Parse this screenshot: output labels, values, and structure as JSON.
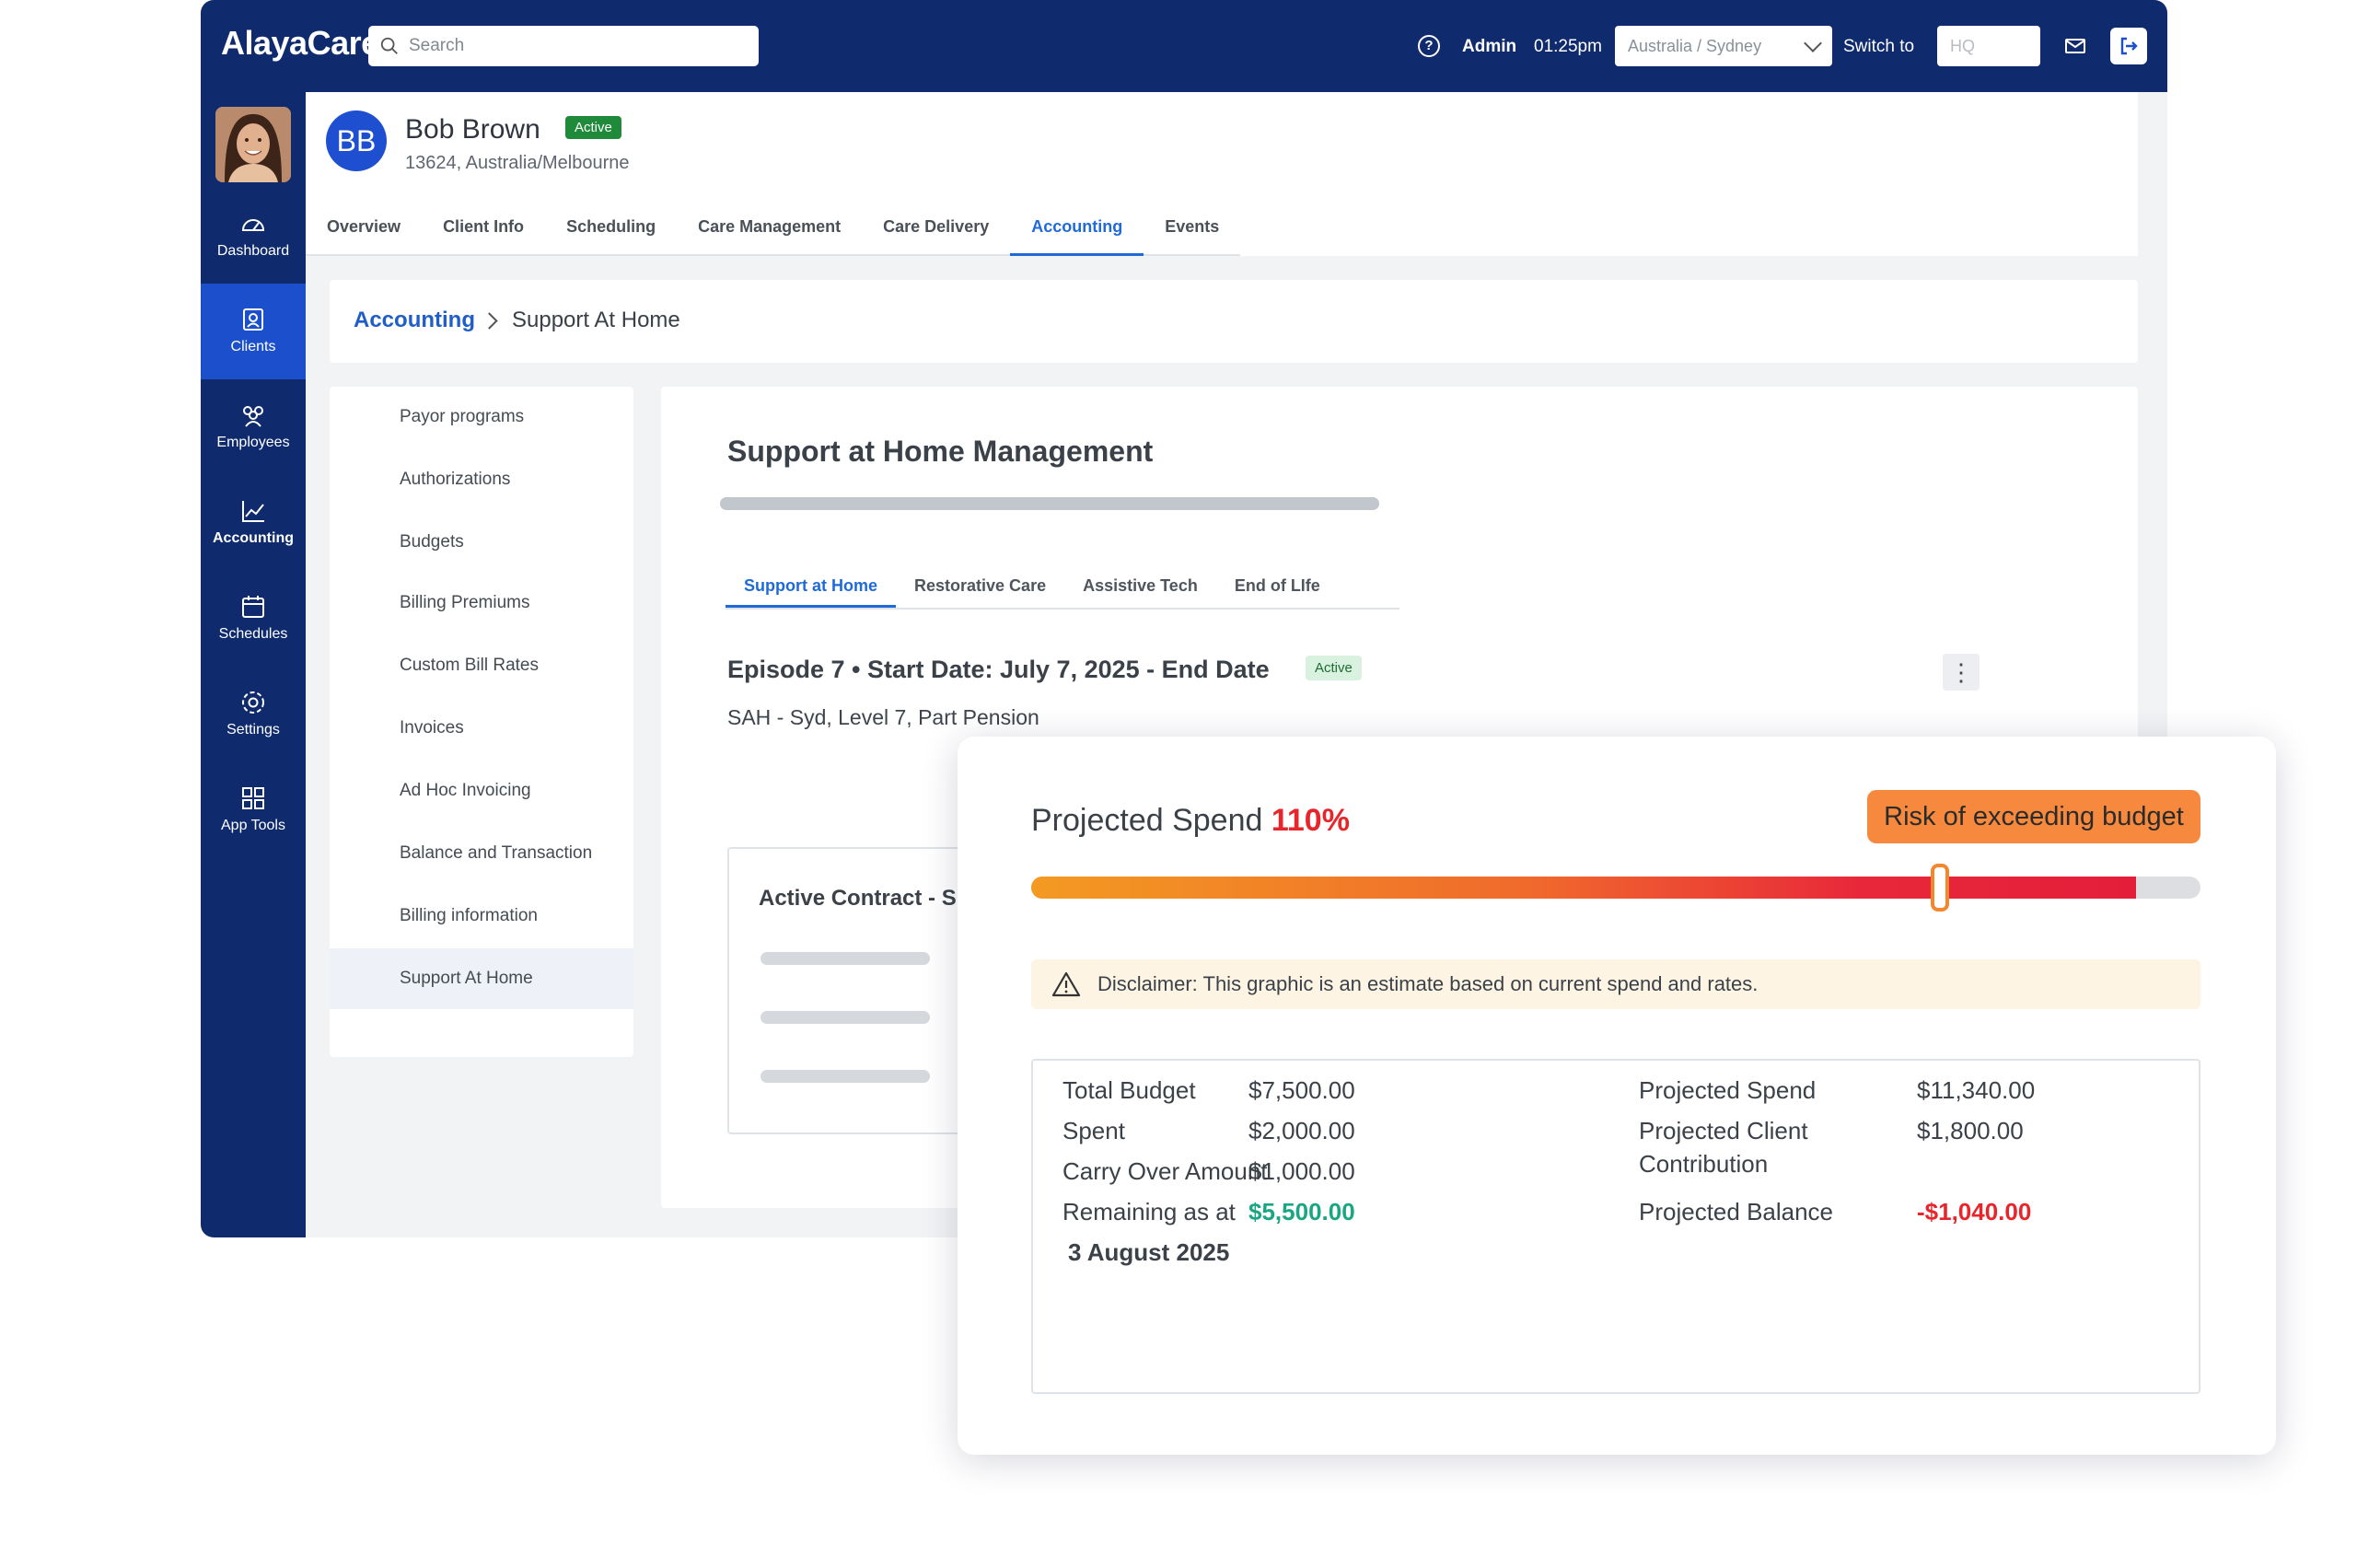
{
  "topbar": {
    "logo": "AlayaCare",
    "search_placeholder": "Search",
    "help_glyph": "?",
    "user": "Admin",
    "time": "01:25pm",
    "timezone": "Australia / Sydney",
    "switch_label": "Switch to",
    "switch_placeholder": "HQ"
  },
  "sidenav": {
    "items": [
      {
        "label": "Dashboard",
        "icon": "dashboard-icon"
      },
      {
        "label": "Clients",
        "icon": "clients-icon"
      },
      {
        "label": "Employees",
        "icon": "employees-icon"
      },
      {
        "label": "Accounting",
        "icon": "accounting-icon"
      },
      {
        "label": "Schedules",
        "icon": "calendar-icon"
      },
      {
        "label": "Settings",
        "icon": "gear-icon"
      },
      {
        "label": "App Tools",
        "icon": "grid-icon"
      }
    ],
    "active": "Clients"
  },
  "client": {
    "initials": "BB",
    "name": "Bob Brown",
    "status": "Active",
    "subtitle": "13624, Australia/Melbourne"
  },
  "tabs": [
    "Overview",
    "Client Info",
    "Scheduling",
    "Care Management",
    "Care Delivery",
    "Accounting",
    "Events"
  ],
  "active_tab": "Accounting",
  "breadcrumb": {
    "parent": "Accounting",
    "current": "Support At Home"
  },
  "left_menu": [
    "Payor programs",
    "Authorizations",
    "Budgets",
    "Billing Premiums",
    "Custom Bill Rates",
    "Invoices",
    "Ad Hoc Invoicing",
    "Balance and Transaction",
    "Billing information",
    "Support At Home"
  ],
  "content": {
    "title": "Support at Home Management",
    "subtabs": [
      "Support at Home",
      "Restorative Care",
      "Assistive Tech",
      "End of LIfe"
    ],
    "episode": "Episode 7 • Start Date: July 7, 2025 - End Date",
    "episode_status": "Active",
    "kebab": "⋮",
    "sah": "SAH - Syd, Level 7, Part Pension",
    "contract_title": "Active Contract - S"
  },
  "projection": {
    "label": "Projected Spend",
    "percent_text": "110%",
    "fill_fraction": 0.945,
    "thumb_fraction": 0.777,
    "risk_label": "Risk of exceeding budget",
    "disclaimer": "Disclaimer: This graphic is an estimate based on current spend and rates.",
    "colors": {
      "over": "#e8252b",
      "risk": "#f6893d",
      "positive": "#1aa683"
    }
  },
  "summary": {
    "total_budget_label": "Total Budget",
    "total_budget": "$7,500.00",
    "spent_label": "Spent",
    "spent": "$2,000.00",
    "carry_label": "Carry Over Amount",
    "carry": "$1,000.00",
    "remaining_label_1": "Remaining as at",
    "remaining_label_2": "3 August 2025",
    "remaining": "$5,500.00",
    "proj_spend_label": "Projected Spend",
    "proj_spend": "$11,340.00",
    "proj_contrib_label_1": "Projected Client",
    "proj_contrib_label_2": "Contribution",
    "proj_contrib": "$1,800.00",
    "proj_balance_label": "Projected Balance",
    "proj_balance": "-$1,040.00"
  }
}
